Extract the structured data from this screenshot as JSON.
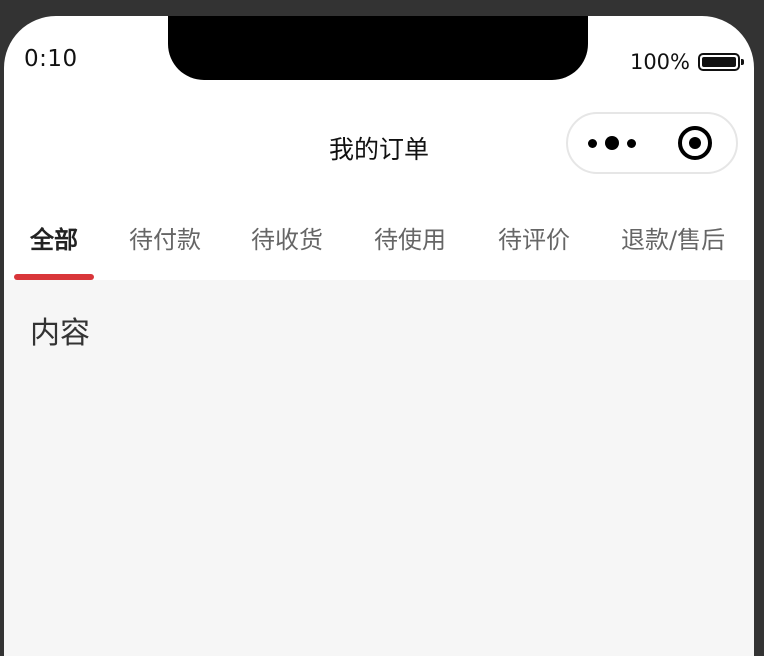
{
  "status_bar": {
    "time": "0:10",
    "battery_percent": "100%",
    "battery_level": 1.0
  },
  "navbar": {
    "title": "我的订单",
    "menu_icon": "more-dots-icon",
    "close_icon": "target-circle-icon"
  },
  "tabs": [
    {
      "label": "全部",
      "active": true
    },
    {
      "label": "待付款",
      "active": false
    },
    {
      "label": "待收货",
      "active": false
    },
    {
      "label": "待使用",
      "active": false
    },
    {
      "label": "待评价",
      "active": false
    },
    {
      "label": "退款/售后",
      "active": false
    }
  ],
  "content": {
    "text": "内容"
  },
  "colors": {
    "accent": "#d9363a",
    "content_bg": "#f6f6f6",
    "frame_bg": "#333333"
  }
}
